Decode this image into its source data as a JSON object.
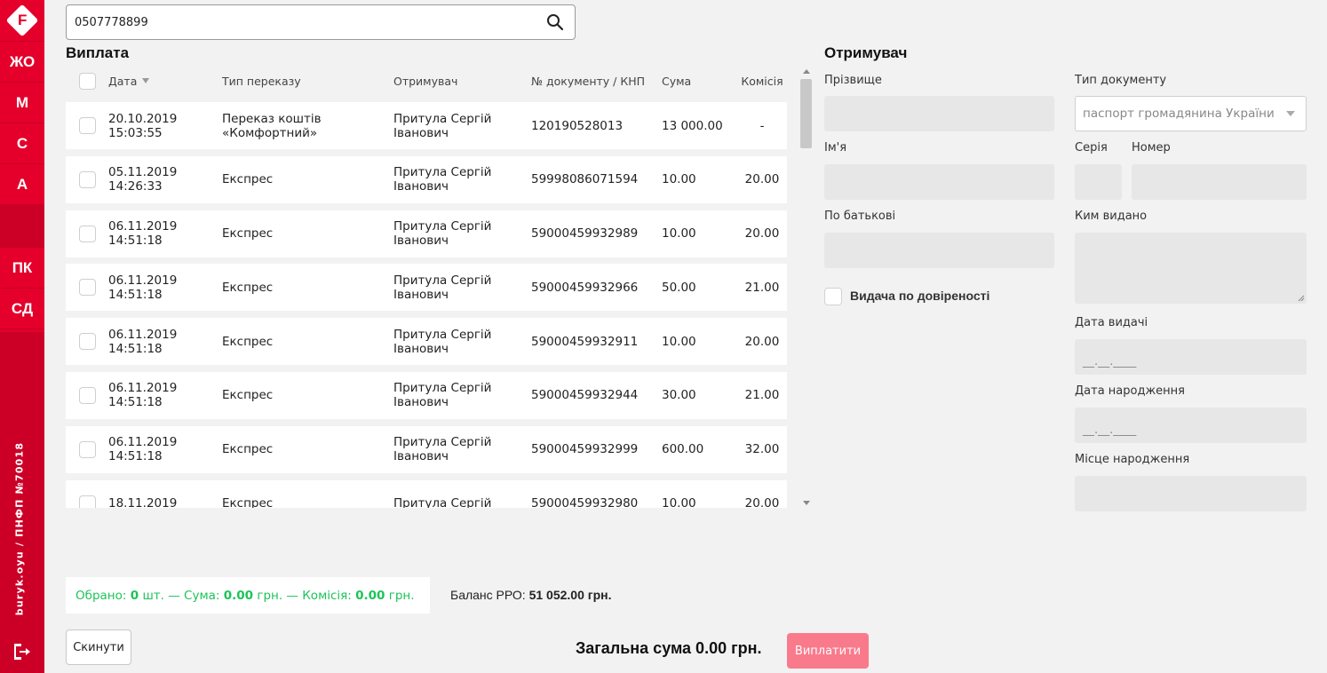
{
  "sidebar": {
    "logo_letter": "F",
    "items": [
      {
        "label": "ЖО"
      },
      {
        "label": "М"
      },
      {
        "label": "С"
      },
      {
        "label": "А"
      },
      {
        "label": "ПК"
      },
      {
        "label": "СД"
      }
    ],
    "footer_text": "buryk.oyu / ПНФП №70018",
    "exit_icon": "logout-icon",
    "colors": {
      "bg": "#e4002b",
      "bg_dark": "#cc0027"
    }
  },
  "search": {
    "value": "0507778899",
    "icon": "search-icon"
  },
  "payout": {
    "title": "Виплата",
    "columns": {
      "date": "Дата",
      "type": "Тип переказу",
      "recipient": "Отримувач",
      "doc": "№ документу / КНП",
      "sum": "Сума",
      "fee": "Комісія"
    },
    "rows": [
      {
        "date": "20.10.2019",
        "time": "15:03:55",
        "type_1": "Переказ коштів",
        "type_2": "«Комфортний»",
        "recv_1": "Притула Сергій",
        "recv_2": "Іванович",
        "doc": "120190528013",
        "sum": "13 000.00",
        "fee": "-"
      },
      {
        "date": "05.11.2019",
        "time": "14:26:33",
        "type_1": "Експрес",
        "type_2": "",
        "recv_1": "Притула Сергій",
        "recv_2": "Іванович",
        "doc": "59998086071594",
        "sum": "10.00",
        "fee": "20.00"
      },
      {
        "date": "06.11.2019",
        "time": "14:51:18",
        "type_1": "Експрес",
        "type_2": "",
        "recv_1": "Притула Сергій",
        "recv_2": "Іванович",
        "doc": "59000459932989",
        "sum": "10.00",
        "fee": "20.00"
      },
      {
        "date": "06.11.2019",
        "time": "14:51:18",
        "type_1": "Експрес",
        "type_2": "",
        "recv_1": "Притула Сергій",
        "recv_2": "Іванович",
        "doc": "59000459932966",
        "sum": "50.00",
        "fee": "21.00"
      },
      {
        "date": "06.11.2019",
        "time": "14:51:18",
        "type_1": "Експрес",
        "type_2": "",
        "recv_1": "Притула Сергій",
        "recv_2": "Іванович",
        "doc": "59000459932911",
        "sum": "10.00",
        "fee": "20.00"
      },
      {
        "date": "06.11.2019",
        "time": "14:51:18",
        "type_1": "Експрес",
        "type_2": "",
        "recv_1": "Притула Сергій",
        "recv_2": "Іванович",
        "doc": "59000459932944",
        "sum": "30.00",
        "fee": "21.00"
      },
      {
        "date": "06.11.2019",
        "time": "14:51:18",
        "type_1": "Експрес",
        "type_2": "",
        "recv_1": "Притула Сергій",
        "recv_2": "Іванович",
        "doc": "59000459932999",
        "sum": "600.00",
        "fee": "32.00"
      },
      {
        "date": "18.11.2019",
        "time": "",
        "type_1": "Експрес",
        "type_2": "",
        "recv_1": "Притула Сергій",
        "recv_2": "",
        "doc": "59000459932980",
        "sum": "10.00",
        "fee": "20.00"
      }
    ]
  },
  "recipient": {
    "title": "Отримувач",
    "surname_label": "Прізвище",
    "name_label": "Ім'я",
    "patronymic_label": "По батькові",
    "proxy_label": "Видача по довіреності",
    "doc_type_label": "Тип документу",
    "doc_type_value": "паспорт громадянина України",
    "series_label": "Серія",
    "number_label": "Номер",
    "issued_by_label": "Ким видано",
    "issue_date_label": "Дата видачі",
    "issue_date_placeholder": "__.__.____",
    "birth_date_label": "Дата народження",
    "birth_date_placeholder": "__.__.____",
    "birth_place_label": "Місце народження"
  },
  "summary": {
    "selected_prefix": "Обрано:",
    "selected_count": "0",
    "selected_unit": "шт. — Сума:",
    "sum_value": "0.00",
    "sum_unit": "грн. — Комісія:",
    "fee_value": "0.00",
    "fee_unit": "грн.",
    "color": "#1ec35a"
  },
  "balance": {
    "label": "Баланс РРО:",
    "value": "51 052.00 грн."
  },
  "footer": {
    "reset_label": "Скинути",
    "total_text": "Загальна сума 0.00 грн.",
    "pay_label": "Виплатити",
    "pay_color": "#f97a8b"
  }
}
